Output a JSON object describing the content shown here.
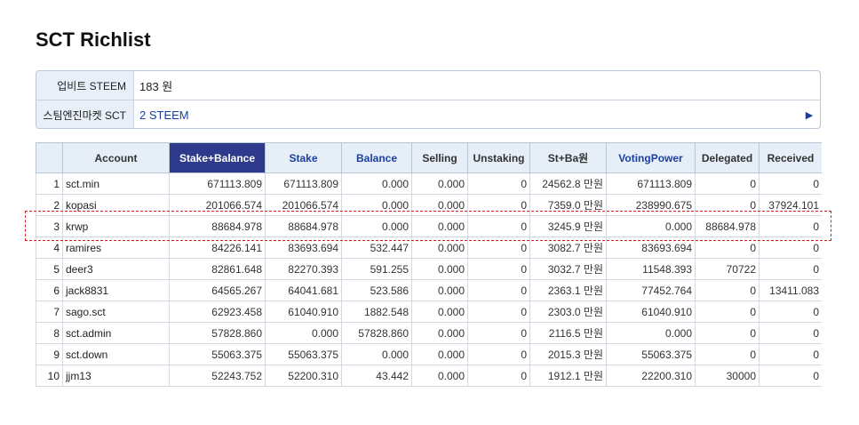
{
  "page": {
    "title": "SCT Richlist"
  },
  "info": [
    {
      "label": "업비트 STEEM",
      "value": "183 원",
      "link": false
    },
    {
      "label": "스팀엔진마켓 SCT",
      "value": "2 STEEM",
      "link": true
    }
  ],
  "table": {
    "sorted_column": "Stake+Balance",
    "headers": [
      "",
      "Account",
      "Stake+Balance",
      "Stake",
      "Balance",
      "Selling",
      "Unstaking",
      "St+Ba원",
      "VotingPower",
      "Delegated",
      "Received"
    ],
    "rows": [
      {
        "rank": "1",
        "account": "sct.min",
        "stake_balance": "671113.809",
        "stake": "671113.809",
        "balance": "0.000",
        "selling": "0.000",
        "unstaking": "0",
        "stba_won": "24562.8 만원",
        "voting_power": "671113.809",
        "delegated": "0",
        "received": "0"
      },
      {
        "rank": "2",
        "account": "kopasi",
        "stake_balance": "201066.574",
        "stake": "201066.574",
        "balance": "0.000",
        "selling": "0.000",
        "unstaking": "0",
        "stba_won": "7359.0 만원",
        "voting_power": "238990.675",
        "delegated": "0",
        "received": "37924.101"
      },
      {
        "rank": "3",
        "account": "krwp",
        "stake_balance": "88684.978",
        "stake": "88684.978",
        "balance": "0.000",
        "selling": "0.000",
        "unstaking": "0",
        "stba_won": "3245.9 만원",
        "voting_power": "0.000",
        "delegated": "88684.978",
        "received": "0"
      },
      {
        "rank": "4",
        "account": "ramires",
        "stake_balance": "84226.141",
        "stake": "83693.694",
        "balance": "532.447",
        "selling": "0.000",
        "unstaking": "0",
        "stba_won": "3082.7 만원",
        "voting_power": "83693.694",
        "delegated": "0",
        "received": "0"
      },
      {
        "rank": "5",
        "account": "deer3",
        "stake_balance": "82861.648",
        "stake": "82270.393",
        "balance": "591.255",
        "selling": "0.000",
        "unstaking": "0",
        "stba_won": "3032.7 만원",
        "voting_power": "11548.393",
        "delegated": "70722",
        "received": "0"
      },
      {
        "rank": "6",
        "account": "jack8831",
        "stake_balance": "64565.267",
        "stake": "64041.681",
        "balance": "523.586",
        "selling": "0.000",
        "unstaking": "0",
        "stba_won": "2363.1 만원",
        "voting_power": "77452.764",
        "delegated": "0",
        "received": "13411.083"
      },
      {
        "rank": "7",
        "account": "sago.sct",
        "stake_balance": "62923.458",
        "stake": "61040.910",
        "balance": "1882.548",
        "selling": "0.000",
        "unstaking": "0",
        "stba_won": "2303.0 만원",
        "voting_power": "61040.910",
        "delegated": "0",
        "received": "0"
      },
      {
        "rank": "8",
        "account": "sct.admin",
        "stake_balance": "57828.860",
        "stake": "0.000",
        "balance": "57828.860",
        "selling": "0.000",
        "unstaking": "0",
        "stba_won": "2116.5 만원",
        "voting_power": "0.000",
        "delegated": "0",
        "received": "0"
      },
      {
        "rank": "9",
        "account": "sct.down",
        "stake_balance": "55063.375",
        "stake": "55063.375",
        "balance": "0.000",
        "selling": "0.000",
        "unstaking": "0",
        "stba_won": "2015.3 만원",
        "voting_power": "55063.375",
        "delegated": "0",
        "received": "0"
      },
      {
        "rank": "10",
        "account": "jjm13",
        "stake_balance": "52243.752",
        "stake": "52200.310",
        "balance": "43.442",
        "selling": "0.000",
        "unstaking": "0",
        "stba_won": "1912.1 만원",
        "voting_power": "22200.310",
        "delegated": "30000",
        "received": "0"
      }
    ]
  },
  "colors": {
    "header_bg": "#e6eef8",
    "active_header_bg": "#2e3a8c",
    "link_blue": "#1a3fa0",
    "highlight_border": "#d62020"
  }
}
